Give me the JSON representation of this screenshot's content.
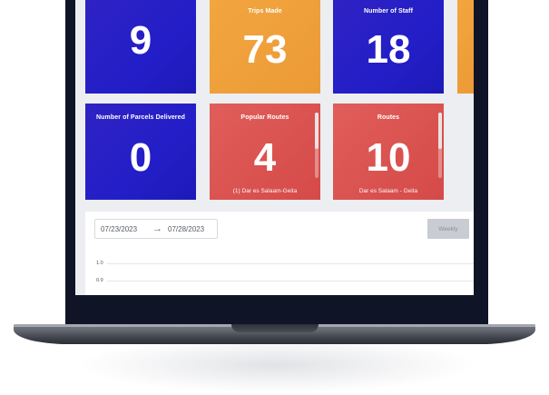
{
  "stats": [
    {
      "label": "",
      "value": "9"
    },
    {
      "label": "Trips Made",
      "value": "73"
    },
    {
      "label": "Number of Staff",
      "value": "18"
    },
    {
      "label": "Number of Parcels Delivered",
      "value": "0"
    },
    {
      "label": "Popular Routes",
      "value": "4",
      "sub": "(1) Dar es Salaam-Geita"
    },
    {
      "label": "Routes",
      "value": "10",
      "sub": "Dar es Salaam - Geita"
    }
  ],
  "date_range": {
    "start": "07/23/2023",
    "arrow": "→",
    "end": "07/28/2023"
  },
  "period_button": "Weekly",
  "chart_axis": {
    "ticks": [
      "1.0",
      "0.9"
    ]
  },
  "colors": {
    "blue": "#2a1fc4",
    "orange": "#f0a23a",
    "red": "#db5451",
    "bezel": "#0f1526"
  }
}
